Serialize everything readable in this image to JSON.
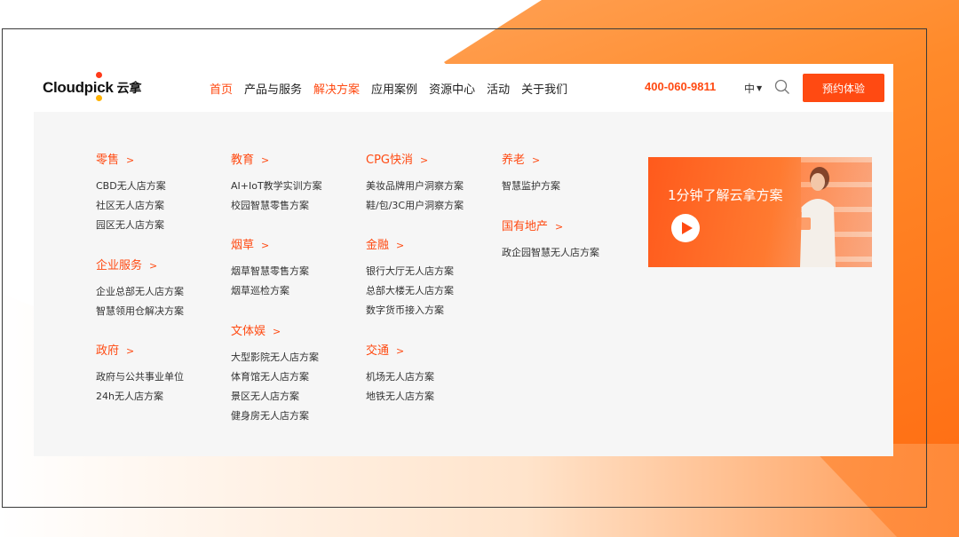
{
  "brand": {
    "name": "Cloudpick",
    "name_pre": "Cloudp",
    "name_i": "i",
    "name_post": "ck",
    "name_cn": "云拿"
  },
  "nav": {
    "links": [
      "首页",
      "产品与服务",
      "解决方案",
      "应用案例",
      "资源中心",
      "活动",
      "关于我们"
    ],
    "active_indices": [
      0,
      2
    ],
    "phone": "400-060-9811",
    "lang": "中",
    "search_icon": "search-icon",
    "cta": "预约体验"
  },
  "menu": {
    "columns": [
      [
        {
          "title": "零售",
          "items": [
            "CBD无人店方案",
            "社区无人店方案",
            "园区无人店方案"
          ]
        },
        {
          "title": "企业服务",
          "items": [
            "企业总部无人店方案",
            "智慧领用仓解决方案"
          ]
        },
        {
          "title": "政府",
          "items": [
            "政府与公共事业单位",
            "24h无人店方案"
          ]
        }
      ],
      [
        {
          "title": "教育",
          "items": [
            "AI+IoT教学实训方案",
            "校园智慧零售方案"
          ]
        },
        {
          "title": "烟草",
          "items": [
            "烟草智慧零售方案",
            "烟草巡检方案"
          ]
        },
        {
          "title": "文体娱",
          "items": [
            "大型影院无人店方案",
            "体育馆无人店方案",
            "景区无人店方案",
            "健身房无人店方案"
          ]
        }
      ],
      [
        {
          "title": "CPG快消",
          "items": [
            "美妆品牌用户洞察方案",
            "鞋/包/3C用户洞察方案"
          ]
        },
        {
          "title": "金融",
          "items": [
            "银行大厅无人店方案",
            "总部大楼无人店方案",
            "数字货币接入方案"
          ]
        },
        {
          "title": "交通",
          "items": [
            "机场无人店方案",
            "地铁无人店方案"
          ]
        }
      ],
      [
        {
          "title": "养老",
          "items": [
            "智慧监护方案"
          ]
        },
        {
          "title": "国有地产",
          "items": [
            "政企园智慧无人店方案"
          ]
        }
      ]
    ],
    "arrow": ">",
    "video": {
      "title": "1分钟了解云拿方案",
      "icon": "play-icon"
    }
  },
  "colors": {
    "accent": "#ff4a12",
    "panel_bg": "#f6f6f6",
    "text": "#333333"
  }
}
